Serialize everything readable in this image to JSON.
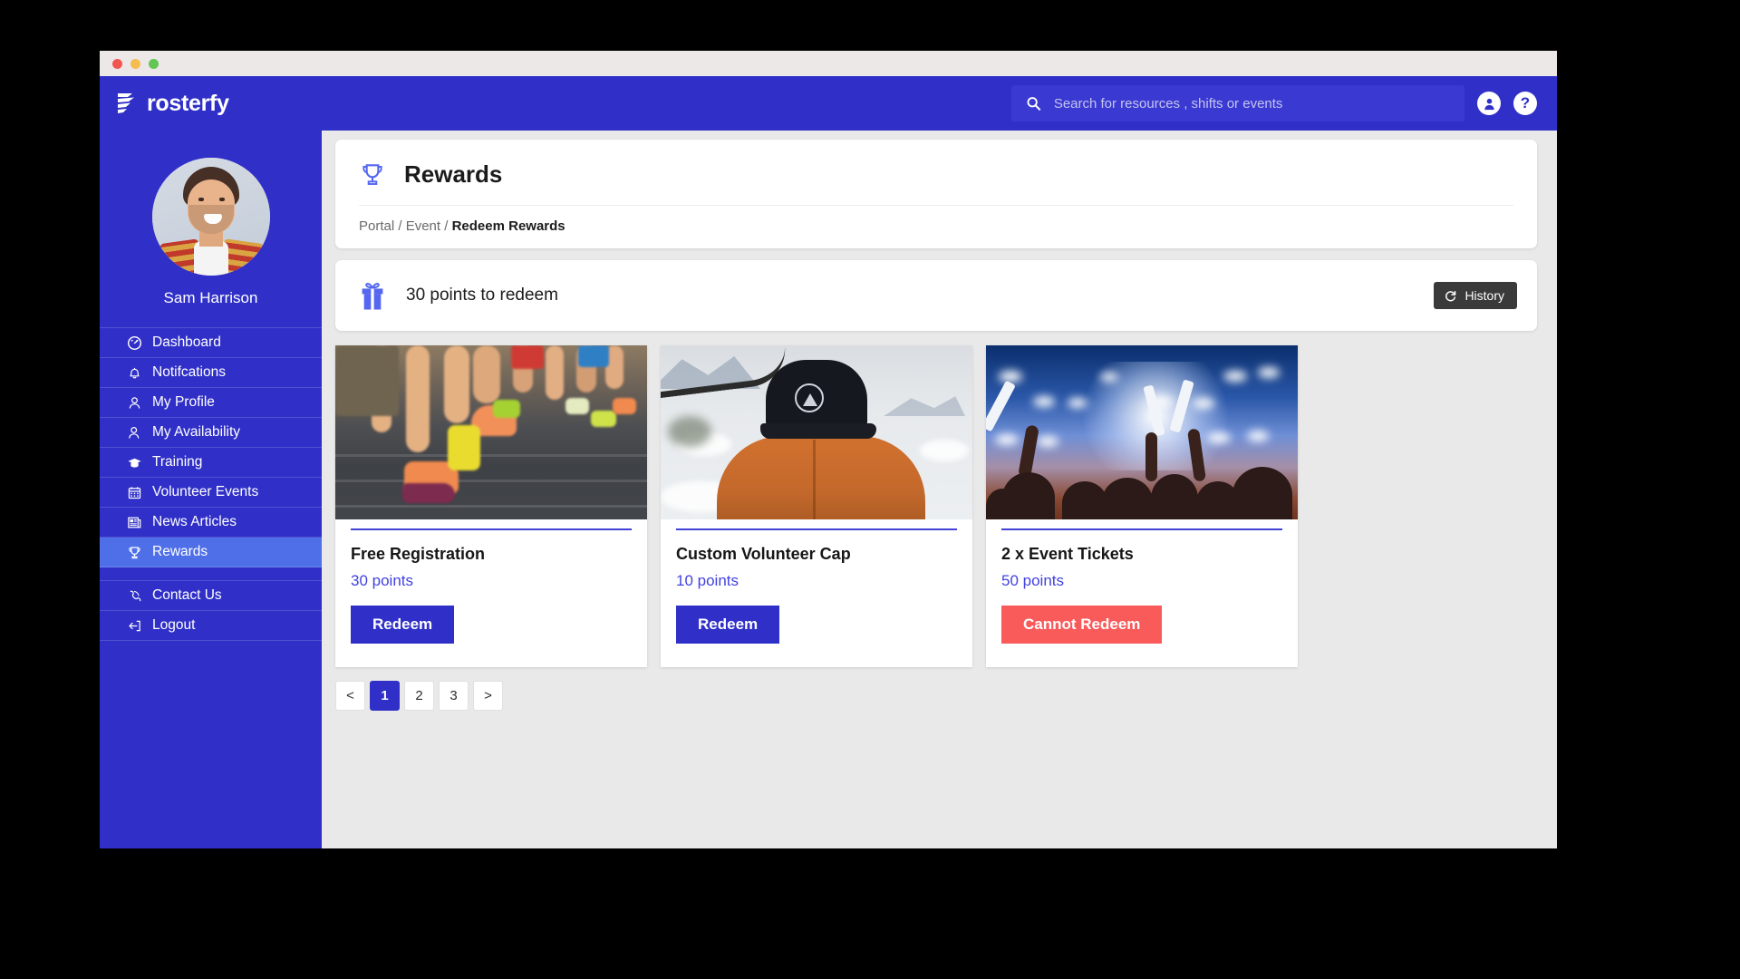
{
  "window": {
    "traffic_lights": [
      "close",
      "minimize",
      "maximize"
    ]
  },
  "topbar": {
    "brand": "rosterfy",
    "search": {
      "placeholder": "Search for resources , shifts or events",
      "value": "",
      "icon": "search-icon"
    },
    "account_icon": "user-circle-icon",
    "help_icon": "help-circle-icon"
  },
  "sidebar": {
    "avatar_alt": "Sam Harrison profile photo",
    "username": "Sam Harrison",
    "items": [
      {
        "label": "Dashboard",
        "icon": "dashboard-icon",
        "active": false
      },
      {
        "label": "Notifcations",
        "icon": "bell-icon",
        "active": false
      },
      {
        "label": "My Profile",
        "icon": "user-icon",
        "active": false
      },
      {
        "label": "My Availability",
        "icon": "user-clock-icon",
        "active": false
      },
      {
        "label": "Training",
        "icon": "graduation-cap-icon",
        "active": false
      },
      {
        "label": "Volunteer Events",
        "icon": "calendar-icon",
        "active": false
      },
      {
        "label": "News Articles",
        "icon": "newspaper-icon",
        "active": false
      },
      {
        "label": "Rewards",
        "icon": "trophy-icon",
        "active": true
      }
    ],
    "secondary_items": [
      {
        "label": "Contact Us",
        "icon": "phone-icon",
        "active": false
      },
      {
        "label": "Logout",
        "icon": "logout-icon",
        "active": false
      }
    ]
  },
  "page": {
    "title": "Rewards",
    "title_icon": "trophy-icon",
    "breadcrumb": {
      "items": [
        "Portal",
        "Event"
      ],
      "separator": "/",
      "current": "Redeem Rewards"
    }
  },
  "points_bar": {
    "icon": "gift-icon",
    "text": "30 points to redeem",
    "history_button": {
      "label": "History",
      "icon": "refresh-icon"
    }
  },
  "rewards": [
    {
      "title": "Free Registration",
      "points": "30 points",
      "image": "marathon-runners-photo",
      "action": {
        "label": "Redeem",
        "state": "enabled"
      }
    },
    {
      "title": "Custom Volunteer Cap",
      "points": "10 points",
      "image": "person-wearing-cap-photo",
      "action": {
        "label": "Redeem",
        "state": "enabled"
      }
    },
    {
      "title": "2 x Event Tickets",
      "points": "50 points",
      "image": "concert-crowd-photo",
      "action": {
        "label": "Cannot Redeem",
        "state": "disabled"
      }
    }
  ],
  "pagination": {
    "prev": "<",
    "next": ">",
    "pages": [
      "1",
      "2",
      "3"
    ],
    "current": "1"
  },
  "colors": {
    "brand_blue": "#3030c8",
    "active_nav_blue": "#4f6fe8",
    "points_link_blue": "#4242e0",
    "cannot_redeem_red": "#f95a5a",
    "history_dark": "#3a3a3a",
    "content_bg": "#e9e9e9"
  }
}
